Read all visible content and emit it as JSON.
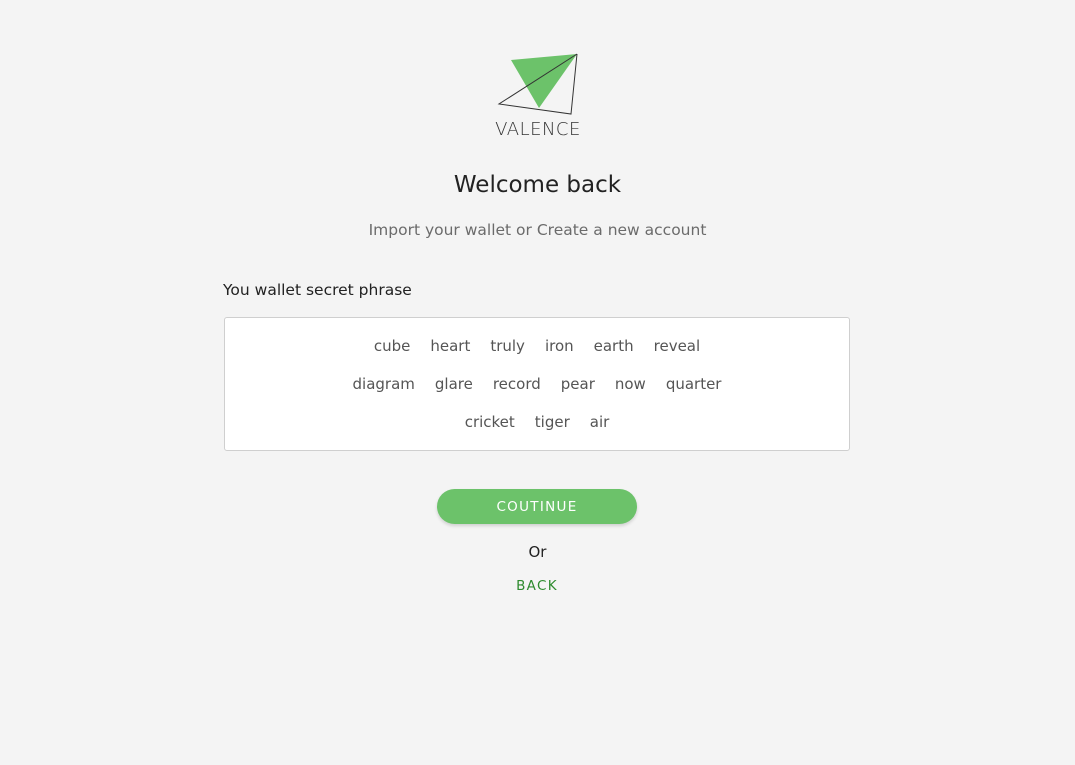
{
  "brand": {
    "name": "VALENCE",
    "accent_color": "#6cc26a",
    "logo_icon": "paper-plane-triangle-icon"
  },
  "header": {
    "title": "Welcome back",
    "subtitle": "Import your wallet or Create a new account"
  },
  "phrase": {
    "label": "You wallet secret phrase",
    "words": [
      "cube",
      "heart",
      "truly",
      "iron",
      "earth",
      "reveal",
      "diagram",
      "glare",
      "record",
      "pear",
      "now",
      "quarter",
      "cricket",
      "tiger",
      "air"
    ]
  },
  "actions": {
    "continue_label": "COUTINUE",
    "or_label": "Or",
    "back_label": "BACK",
    "link_color": "#2e8b2e"
  }
}
